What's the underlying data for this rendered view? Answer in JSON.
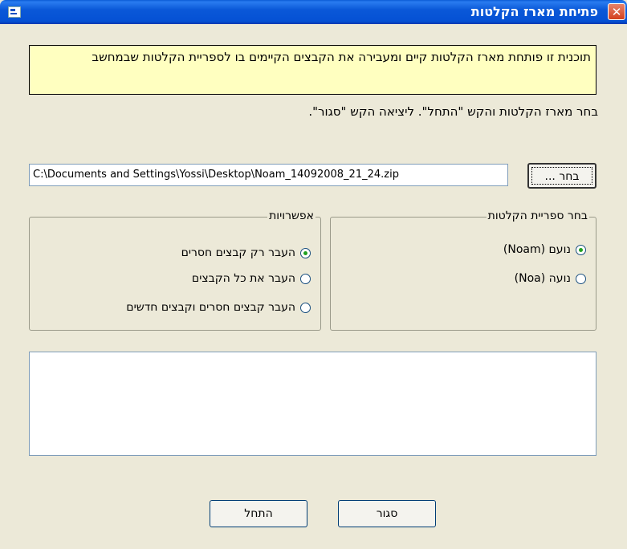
{
  "window": {
    "title": "פתיחת מארז הקלטות",
    "close_symbol": "✕"
  },
  "info_text": "תוכנית זו פותחת מארז הקלטות קיים ומעבירה את הקבצים הקיימים בו לספריית הקלטות שבמחשב",
  "instruction": "בחר מארז הקלטות והקש \"התחל\". ליציאה הקש \"סגור\".",
  "file": {
    "path": "C:\\Documents and Settings\\Yossi\\Desktop\\Noam_14092008_21_24.zip",
    "browse_label": "בחר ..."
  },
  "library_group": {
    "legend": "בחר ספריית הקלטות",
    "options": [
      {
        "label": "נועם (Noam)",
        "checked": true
      },
      {
        "label": "נועה (Noa)",
        "checked": false
      }
    ]
  },
  "options_group": {
    "legend": "אפשרויות",
    "options": [
      {
        "label": "העבר רק קבצים חסרים",
        "checked": true
      },
      {
        "label": "העבר את כל הקבצים",
        "checked": false
      },
      {
        "label": "העבר קבצים חסרים וקבצים חדשים",
        "checked": false
      }
    ]
  },
  "output_text": "",
  "buttons": {
    "close_label": "סגור",
    "start_label": "התחל"
  },
  "colors": {
    "title_bar": "#0a58d8",
    "info_background": "#ffffc0",
    "dialog_background": "#ece9d8",
    "radio_dot": "#21a121"
  },
  "icons": {
    "app": "app-window-icon",
    "close": "close-icon"
  }
}
